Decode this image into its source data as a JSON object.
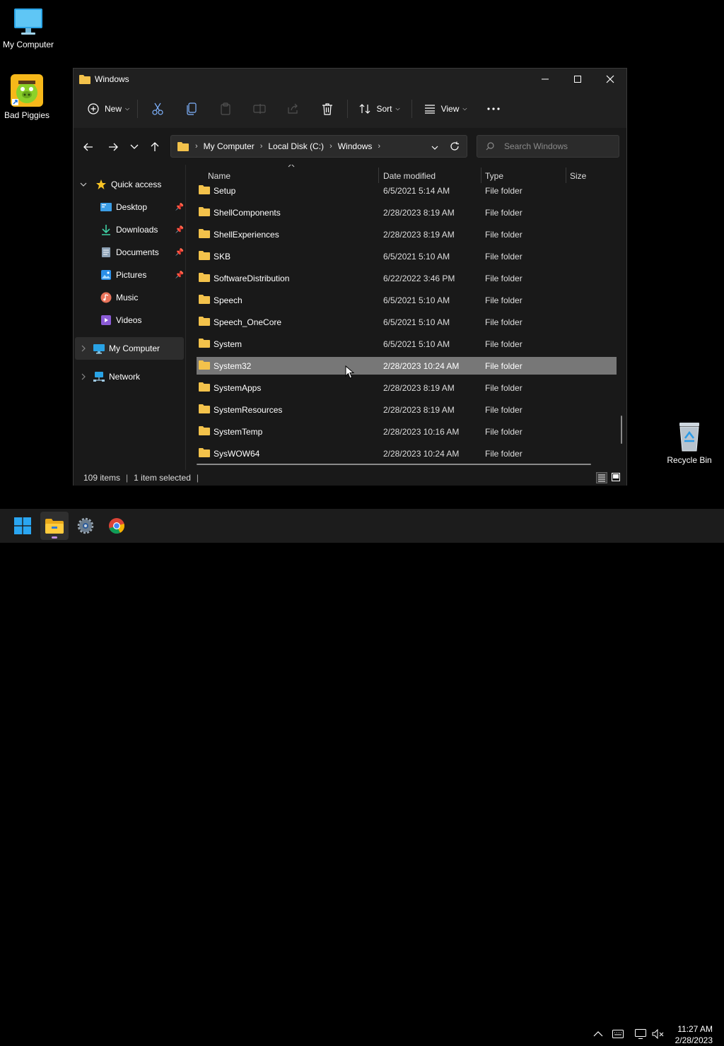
{
  "desktop": {
    "icons": [
      {
        "label": "My Computer",
        "icon": "monitor-icon"
      },
      {
        "label": "Bad Piggies",
        "icon": "bad-piggies-icon"
      },
      {
        "label": "Recycle Bin",
        "icon": "recycle-bin-icon"
      }
    ]
  },
  "window": {
    "title": "Windows",
    "toolbar": {
      "new_label": "New",
      "sort_label": "Sort",
      "view_label": "View"
    },
    "address": {
      "crumbs": [
        "My Computer",
        "Local Disk (C:)",
        "Windows"
      ]
    },
    "search": {
      "placeholder": "Search Windows"
    },
    "sidebar": {
      "quick_access": "Quick access",
      "items": [
        {
          "label": "Desktop",
          "icon": "desktop-folder-icon",
          "pinned": true
        },
        {
          "label": "Downloads",
          "icon": "download-icon",
          "pinned": true
        },
        {
          "label": "Documents",
          "icon": "documents-icon",
          "pinned": true
        },
        {
          "label": "Pictures",
          "icon": "pictures-icon",
          "pinned": true
        },
        {
          "label": "Music",
          "icon": "music-icon",
          "pinned": false
        },
        {
          "label": "Videos",
          "icon": "videos-icon",
          "pinned": false
        }
      ],
      "my_computer": "My Computer",
      "network": "Network"
    },
    "columns": {
      "name": "Name",
      "date": "Date modified",
      "type": "Type",
      "size": "Size"
    },
    "rows": [
      {
        "name": "Setup",
        "date": "6/5/2021 5:14 AM",
        "type": "File folder"
      },
      {
        "name": "ShellComponents",
        "date": "2/28/2023 8:19 AM",
        "type": "File folder"
      },
      {
        "name": "ShellExperiences",
        "date": "2/28/2023 8:19 AM",
        "type": "File folder"
      },
      {
        "name": "SKB",
        "date": "6/5/2021 5:10 AM",
        "type": "File folder"
      },
      {
        "name": "SoftwareDistribution",
        "date": "6/22/2022 3:46 PM",
        "type": "File folder"
      },
      {
        "name": "Speech",
        "date": "6/5/2021 5:10 AM",
        "type": "File folder"
      },
      {
        "name": "Speech_OneCore",
        "date": "6/5/2021 5:10 AM",
        "type": "File folder"
      },
      {
        "name": "System",
        "date": "6/5/2021 5:10 AM",
        "type": "File folder"
      },
      {
        "name": "System32",
        "date": "2/28/2023 10:24 AM",
        "type": "File folder",
        "selected": true
      },
      {
        "name": "SystemApps",
        "date": "2/28/2023 8:19 AM",
        "type": "File folder"
      },
      {
        "name": "SystemResources",
        "date": "2/28/2023 8:19 AM",
        "type": "File folder"
      },
      {
        "name": "SystemTemp",
        "date": "2/28/2023 10:16 AM",
        "type": "File folder"
      },
      {
        "name": "SysWOW64",
        "date": "2/28/2023 10:24 AM",
        "type": "File folder"
      }
    ],
    "status": {
      "count": "109 items",
      "selected": "1 item selected"
    }
  },
  "taskbar": {
    "apps": [
      {
        "icon": "start-icon"
      },
      {
        "icon": "file-explorer-icon",
        "active": true
      },
      {
        "icon": "settings-icon"
      },
      {
        "icon": "chrome-icon"
      }
    ],
    "time": "11:27 AM",
    "date": "2/28/2023"
  },
  "colors": {
    "selection": "#777777",
    "folder": "#f3c24b",
    "accent": "#0078d4"
  }
}
